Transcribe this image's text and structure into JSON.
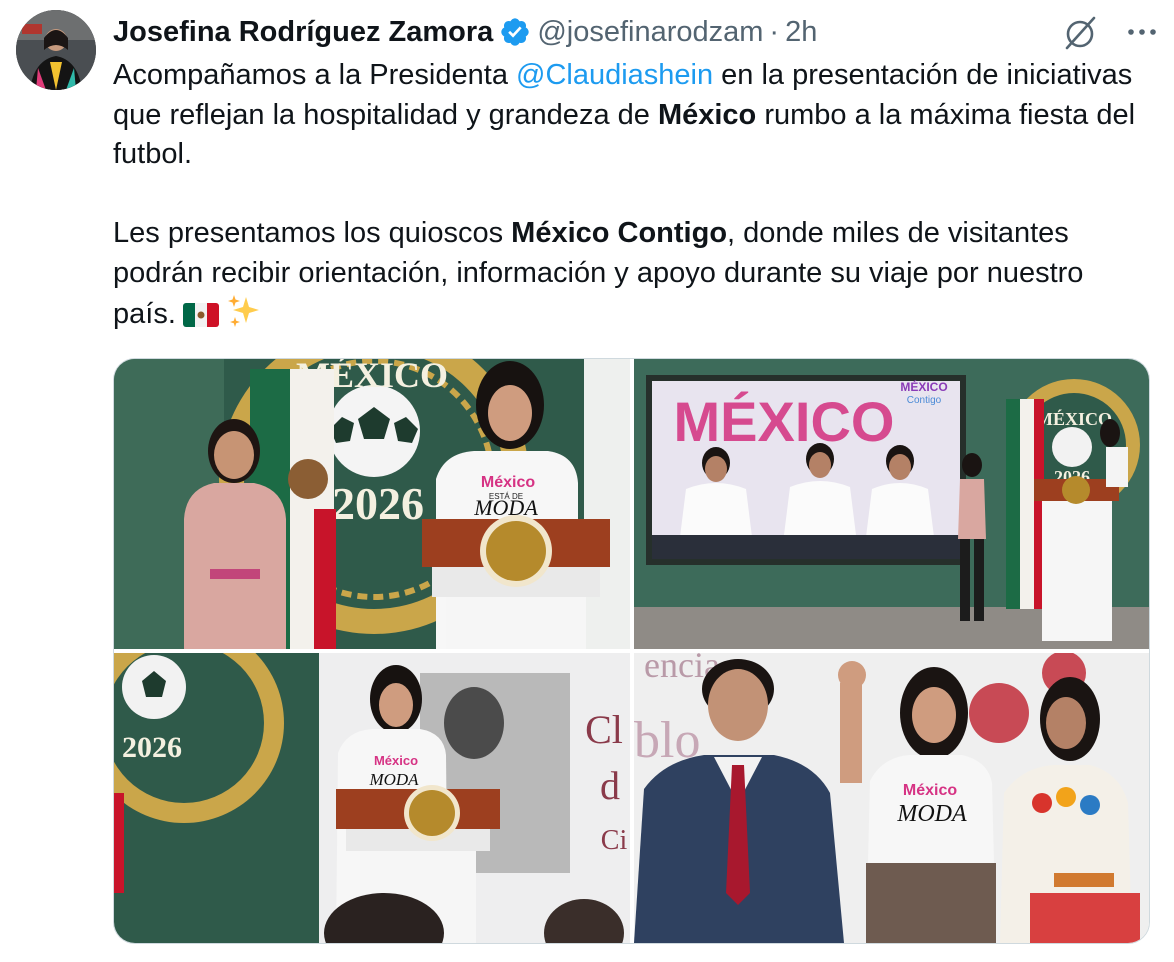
{
  "author": {
    "display_name": "Josefina Rodríguez Zamora",
    "handle": "@josefinarodzam",
    "separator": "·",
    "time": "2h",
    "verified": true
  },
  "tweet": {
    "p1": {
      "t1": "Acompañamos a la Presidenta ",
      "mention": "@Claudiashein",
      "t2": " en la presentación de iniciativas que reflejan la hospitalidad y grandeza de ",
      "bold": "México",
      "t3": " rumbo a la máxima fiesta del futbol."
    },
    "p2": {
      "t1": "Les presentamos los quioscos ",
      "bold": "México Contigo",
      "t2": ", donde miles de visitantes podrán recibir orientación, información y apoyo durante su viaje por nuestro país."
    }
  },
  "media": {
    "photo1": {
      "banner": "MÉXICO",
      "year": "2026",
      "shirt_brand": "México",
      "shirt_sub": "ESTÁ DE",
      "shirt_word": "MODA"
    },
    "photo2": {
      "screen_word": "MÉXICO",
      "screen_logo": "MÉXICO",
      "screen_logo_sub": "Contigo",
      "banner": "MÉXICO",
      "year": "2026"
    },
    "photo3": {
      "year": "2026",
      "shirt_brand": "México",
      "shirt_word": "MODA",
      "backdrop_a": "Cl",
      "backdrop_b": "d",
      "backdrop_c": "Ci"
    },
    "photo4": {
      "backdrop_a": "encia",
      "backdrop_b": "blo",
      "shirt_brand": "México",
      "shirt_word": "MODA"
    }
  },
  "colors": {
    "text": "#0f1419",
    "secondary": "#536471",
    "link": "#1d9bf0",
    "border": "#cfd9de"
  },
  "icons": {
    "verified": "verified-badge-icon",
    "grok": "grok-icon",
    "more": "more-icon",
    "emoji_flag": "mexico-flag-emoji",
    "emoji_sparkles": "sparkles-emoji"
  }
}
